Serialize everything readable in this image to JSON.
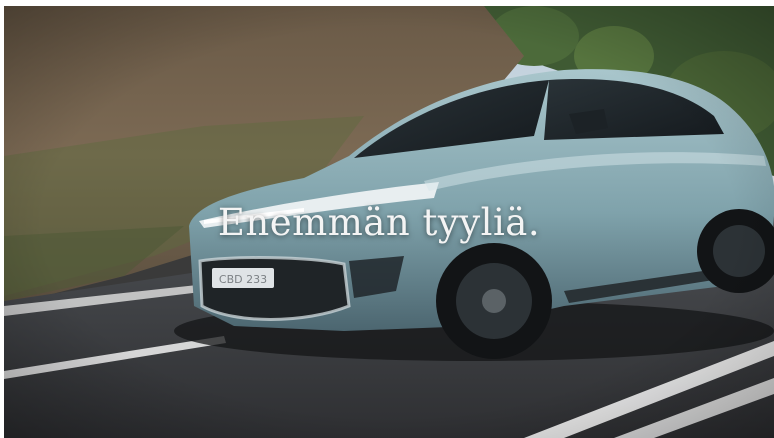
{
  "video": {
    "caption": "Enemmän tyyliä.",
    "scene": "Light blue electric car driving on a road past a hillside",
    "license_plate": "CBD-233"
  },
  "colors": {
    "car_body": "#8fb0b8",
    "sky": "#c9d8e4",
    "road": "#3c3d40",
    "caption_text": "#f4f4f4"
  }
}
